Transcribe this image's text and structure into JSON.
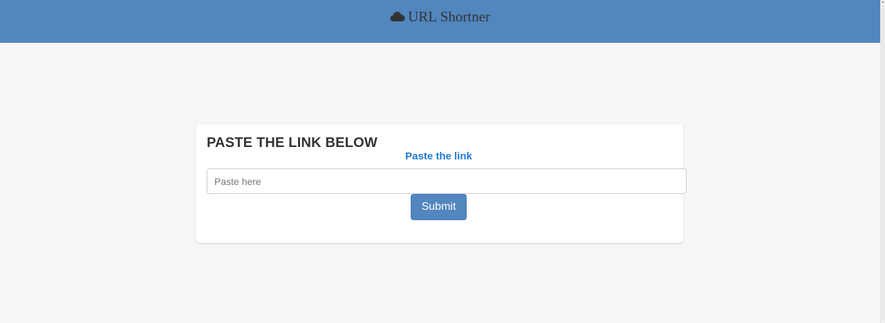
{
  "navbar": {
    "brand_text": "URL Shortner",
    "brand_icon": "cloud-icon",
    "background_color": "#5186bf"
  },
  "card": {
    "title": "PASTE THE LINK BELOW",
    "label": "Paste the link",
    "input": {
      "value": "",
      "placeholder": "Paste here"
    },
    "submit_label": "Submit"
  },
  "colors": {
    "page_background": "#f7f7f7",
    "accent": "#5186bf",
    "label_link": "#1e7ad6",
    "title_text": "#333333"
  }
}
